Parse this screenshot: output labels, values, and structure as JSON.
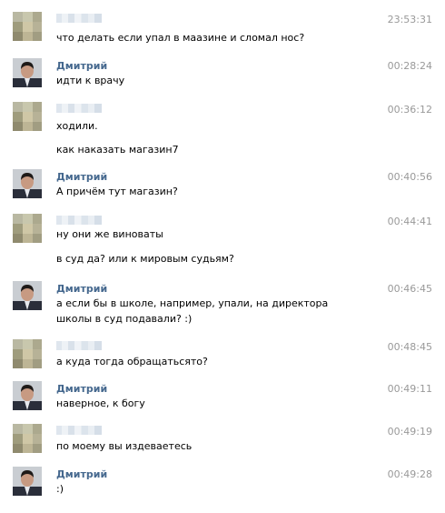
{
  "messages": [
    {
      "sender": "",
      "time": "23:53:31",
      "lines": [
        "что делать если упал в маазине и сломал нос?"
      ]
    },
    {
      "sender": "Дмитрий",
      "time": "00:28:24",
      "lines": [
        "идти к врачу"
      ]
    },
    {
      "sender": "",
      "time": "00:36:12",
      "lines": [
        "ходили.",
        "как наказать магазин7"
      ]
    },
    {
      "sender": "Дмитрий",
      "time": "00:40:56",
      "lines": [
        "А причём тут магазин?"
      ]
    },
    {
      "sender": "",
      "time": "00:44:41",
      "lines": [
        "ну они же виноваты",
        "в суд да? или к мировым судьям?"
      ]
    },
    {
      "sender": "Дмитрий",
      "time": "00:46:45",
      "lines": [
        "а если бы в школе, например, упали, на директора школы в суд подавали? :)"
      ]
    },
    {
      "sender": "",
      "time": "00:48:45",
      "lines": [
        "а куда тогда обращатьсято?"
      ]
    },
    {
      "sender": "Дмитрий",
      "time": "00:49:11",
      "lines": [
        "наверное, к богу"
      ]
    },
    {
      "sender": "",
      "time": "00:49:19",
      "lines": [
        "по моему вы издеваетесь"
      ]
    },
    {
      "sender": "Дмитрий",
      "time": "00:49:28",
      "lines": [
        ":)"
      ]
    }
  ]
}
